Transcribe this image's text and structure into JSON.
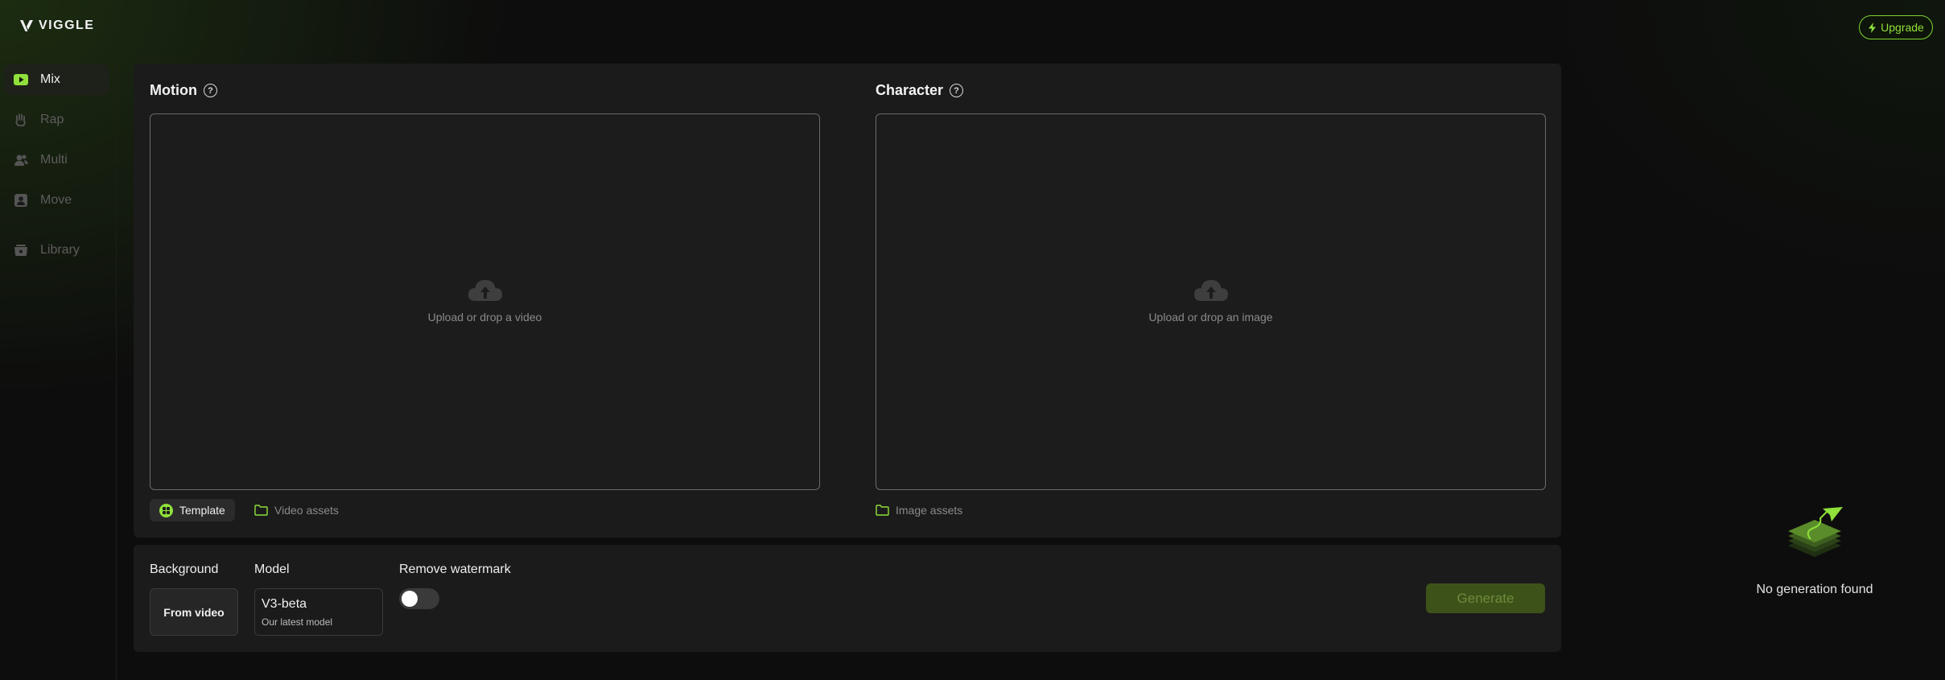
{
  "brand": {
    "name": "VIGGLE",
    "accent": "#8fe03a"
  },
  "header": {
    "upgrade_label": "Upgrade",
    "upgrade_icon": "lightning-icon"
  },
  "sidebar": {
    "items": [
      {
        "label": "Mix",
        "icon": "play-icon",
        "active": true
      },
      {
        "label": "Rap",
        "icon": "hand-icon",
        "active": false
      },
      {
        "label": "Multi",
        "icon": "people-icon",
        "active": false
      },
      {
        "label": "Move",
        "icon": "person-box-icon",
        "active": false
      },
      {
        "label": "Library",
        "icon": "library-icon",
        "active": false
      }
    ]
  },
  "motion": {
    "title": "Motion",
    "upload_text": "Upload or drop a video",
    "tabs": [
      {
        "label": "Template",
        "icon": "template-icon",
        "active": true
      },
      {
        "label": "Video assets",
        "icon": "folder-icon",
        "active": false
      }
    ]
  },
  "character": {
    "title": "Character",
    "upload_text": "Upload or drop an image",
    "tabs": [
      {
        "label": "Image assets",
        "icon": "folder-icon",
        "active": false
      }
    ]
  },
  "settings": {
    "background_label": "Background",
    "background_value": "From video",
    "model_label": "Model",
    "model_value": "V3-beta",
    "model_sub": "Our latest model",
    "watermark_label": "Remove watermark",
    "watermark_on": false,
    "generate_label": "Generate"
  },
  "history": {
    "empty_text": "No generation found"
  }
}
